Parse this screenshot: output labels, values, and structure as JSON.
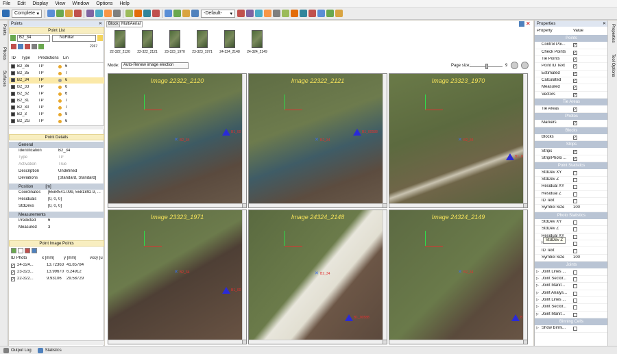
{
  "menu": [
    "File",
    "Edit",
    "Display",
    "View",
    "Window",
    "Options",
    "Help"
  ],
  "toolbar": {
    "mode": "Complete",
    "preset": "-Default-"
  },
  "left_tabs": [
    "Points",
    "Photos",
    "Surfaces"
  ],
  "points_panel": {
    "title": "Points",
    "list_header": "Point List",
    "search_value": "B2_34",
    "filter_value": "NoFilter",
    "count": "2267",
    "columns": [
      "ID",
      "Type",
      "Predictions",
      "Lin"
    ],
    "rows": [
      {
        "id": "B2_36",
        "type": "TP",
        "pred": "6"
      },
      {
        "id": "B2_35",
        "type": "TP",
        "pred": "7"
      },
      {
        "id": "B2_34",
        "type": "TP",
        "pred": "6"
      },
      {
        "id": "B2_33",
        "type": "TP",
        "pred": "6"
      },
      {
        "id": "B2_32",
        "type": "TP",
        "pred": "6"
      },
      {
        "id": "B2_31",
        "type": "TP",
        "pred": "7"
      },
      {
        "id": "B2_30",
        "type": "TP",
        "pred": "7"
      },
      {
        "id": "B2_3",
        "type": "TP",
        "pred": "9"
      },
      {
        "id": "B2_2G",
        "type": "TP",
        "pred": "6"
      }
    ]
  },
  "point_details": {
    "title": "Point Details",
    "general": "General",
    "rows": [
      {
        "label": "Identification",
        "value": "B2_34"
      },
      {
        "label": "Type",
        "value": "TP"
      },
      {
        "label": "Activation",
        "value": "True"
      },
      {
        "label": "Description",
        "value": "Undefined"
      },
      {
        "label": "Deviations",
        "value": "[Standard, Standard]"
      }
    ],
    "position_hdr": "Position",
    "position_unit": "[m]",
    "pos_rows": [
      {
        "label": "Coordinates",
        "value": "[6584541.099, 5581892.9, ..."
      },
      {
        "label": "Residuals",
        "value": "[0, 0, 0]"
      },
      {
        "label": "StdDevs",
        "value": "[0, 0, 0]"
      }
    ],
    "meas_hdr": "Measurements",
    "meas_rows": [
      {
        "label": "Predicted",
        "value": "6"
      },
      {
        "label": "Measured",
        "value": "3"
      }
    ]
  },
  "point_image_points": {
    "title": "Point Image Points",
    "columns": [
      "ID Photo",
      "x [mm]",
      "y [mm]",
      "vxcy [u"
    ],
    "rows": [
      {
        "id": "24-324...",
        "x": "13.72363",
        "y": "41.85784"
      },
      {
        "id": "23-323...",
        "x": "13.99670",
        "y": "6.24912"
      },
      {
        "id": "22-322...",
        "x": "9.93106",
        "y": "29.58729"
      }
    ]
  },
  "center": {
    "tabs": [
      "Block",
      "MultiAerial"
    ],
    "thumbs": [
      "22-322_2120",
      "22-322_2121",
      "23-323_1970",
      "23-323_1971",
      "24-324_2148",
      "24-324_2149"
    ],
    "mode_label": "Mode:",
    "mode_value": "Auto-Renew image election",
    "page_size_label": "Page size:",
    "page_size_value": "9",
    "tiles": [
      {
        "title": "Image 22322_2120",
        "p1": "B2_34",
        "p2": "B1_00"
      },
      {
        "title": "Image 22322_2121",
        "p1": "B2_34",
        "p2": "B1_00588"
      },
      {
        "title": "Image 23323_1970",
        "p1": "B2_34",
        "p2": "B1_00588"
      },
      {
        "title": "Image 23323_1971",
        "p1": "B2_34",
        "p2": "B1_00"
      },
      {
        "title": "Image 24324_2148",
        "p1": "B2_34",
        "p2": "B1_00588"
      },
      {
        "title": "Image 24324_2149",
        "p1": "B2_34",
        "p2": "B1_00"
      }
    ]
  },
  "properties": {
    "title": "Properties",
    "col_prop": "Property",
    "col_val": "Value",
    "tooltip": "StdDev Z",
    "sections": [
      {
        "name": "Points",
        "rows": [
          {
            "l": "Control Poi...",
            "v": "chk"
          },
          {
            "l": "Check Points",
            "v": "chk"
          },
          {
            "l": "Tie Points",
            "v": "chk"
          },
          {
            "l": "Point ID Text",
            "v": "chk"
          },
          {
            "l": "Estimated",
            "v": "chk"
          },
          {
            "l": "Calculated",
            "v": "chk"
          },
          {
            "l": "Measured",
            "v": "chk"
          },
          {
            "l": "Vectors",
            "v": "chk"
          }
        ]
      },
      {
        "name": "Tie Areas",
        "rows": [
          {
            "l": "Tie Areas",
            "v": "chk"
          }
        ]
      },
      {
        "name": "Photos",
        "rows": [
          {
            "l": "Markers",
            "v": "chk"
          }
        ]
      },
      {
        "name": "Blocks",
        "rows": [
          {
            "l": "Blocks",
            "v": "chk"
          }
        ]
      },
      {
        "name": "Strips",
        "rows": [
          {
            "l": "Strips",
            "v": "chk"
          },
          {
            "l": "Strip/Photo ...",
            "v": "chk"
          }
        ]
      },
      {
        "name": "Point Statistics",
        "rows": [
          {
            "l": "StdDev XY",
            "v": "box"
          },
          {
            "l": "StdDev Z",
            "v": "box"
          },
          {
            "l": "Residual XY",
            "v": "box"
          },
          {
            "l": "Residual Z",
            "v": "box"
          },
          {
            "l": "ID Text",
            "v": "box"
          },
          {
            "l": "Symbol Size",
            "v": "100"
          }
        ]
      },
      {
        "name": "Photo Statistics",
        "rows": [
          {
            "l": "StdDev XY",
            "v": "box"
          },
          {
            "l": "StdDev Z",
            "v": "box"
          },
          {
            "l": "Residual XY",
            "v": "box"
          },
          {
            "l": "Residual Z",
            "v": "box"
          },
          {
            "l": "ID Text",
            "v": "box"
          },
          {
            "l": "Symbol Size",
            "v": "100"
          }
        ]
      },
      {
        "name": "Joints",
        "rows": [
          {
            "l": "Joint Lines ...",
            "v": "box"
          },
          {
            "l": "Joint Sector...",
            "v": "box"
          },
          {
            "l": "Joint Manif...",
            "v": "box"
          },
          {
            "l": "Joint Analys...",
            "v": "box"
          },
          {
            "l": "Joint Lines ...",
            "v": "box"
          },
          {
            "l": "Joint Sector...",
            "v": "box"
          },
          {
            "l": "Joint Manif...",
            "v": "box"
          }
        ]
      },
      {
        "name": "Binning Cells",
        "rows": [
          {
            "l": "Show Binni...",
            "v": "box"
          }
        ]
      }
    ]
  },
  "right_tabs": [
    "Properties",
    "Tool Options"
  ],
  "status": {
    "output": "Output Log",
    "stats": "Statistics"
  }
}
